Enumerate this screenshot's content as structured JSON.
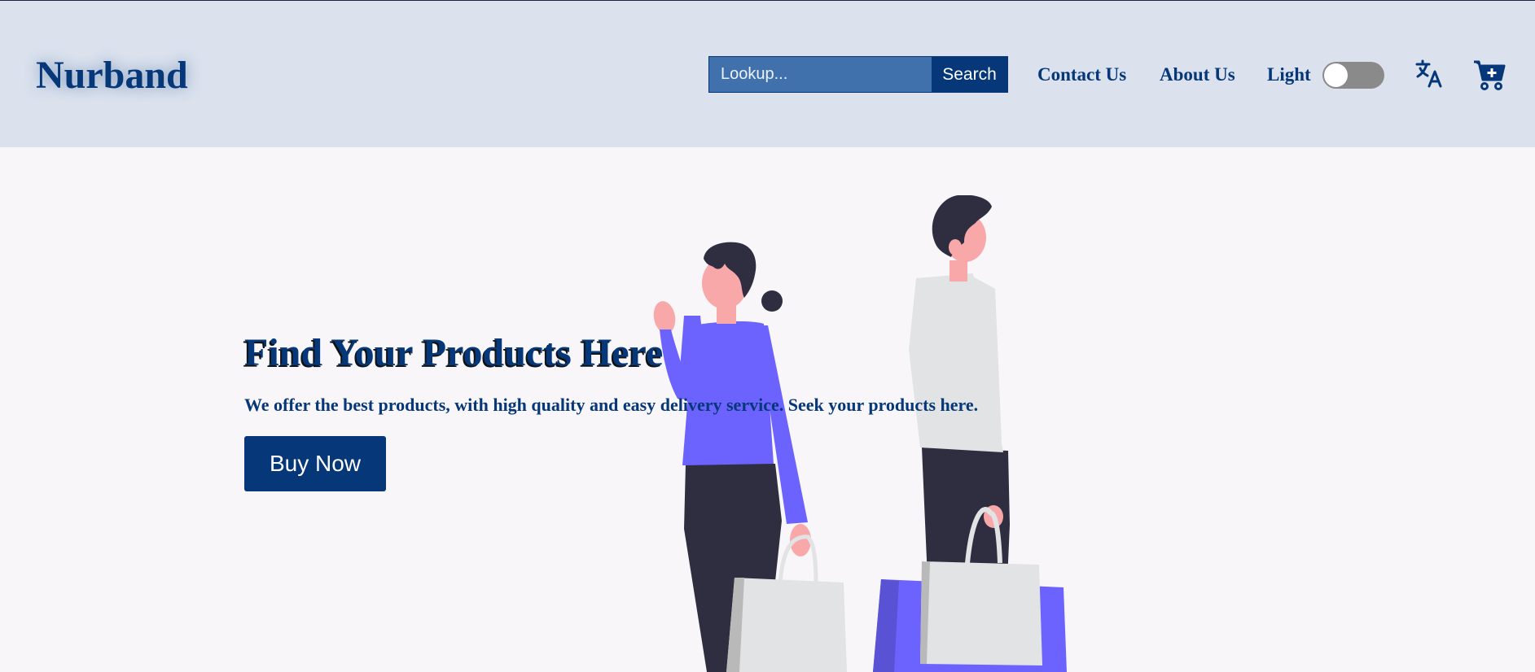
{
  "header": {
    "logo": "Nurband",
    "search": {
      "placeholder": "Lookup...",
      "value": "",
      "button_label": "Search"
    },
    "nav": {
      "contact": "Contact Us",
      "about": "About Us",
      "theme_label": "Light",
      "theme_toggle_on": false
    },
    "icons": {
      "translate": "translate-icon",
      "cart": "cart-add-icon"
    }
  },
  "hero": {
    "title": "Find Your Products Here",
    "subtitle": "We offer the best products, with high quality and easy delivery service. Seek your products here.",
    "button_label": "Buy Now",
    "illustration": "shoppers-with-bags-illustration"
  },
  "colors": {
    "brand": "#053779",
    "header_bg": "#dbe2ee",
    "page_bg": "#f8f6f8",
    "search_input_bg": "#4171ad",
    "accent_purple": "#6c63ff"
  }
}
